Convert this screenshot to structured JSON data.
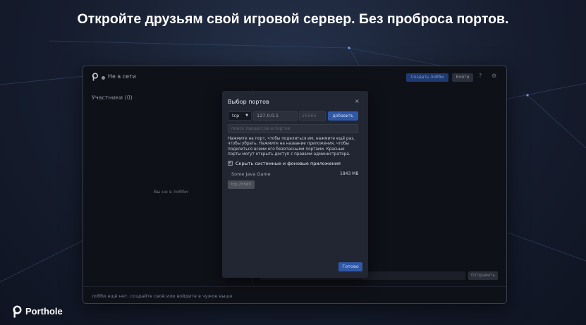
{
  "headline": "Откройте друзьям свой игровой сервер. Без проброса портов.",
  "app": {
    "status": "Не в сети",
    "create_lobby_label": "Создать лобби",
    "login_label": "Войти",
    "help_icon": "question-icon",
    "settings_icon": "gear-icon",
    "participants_label": "Участники (0)",
    "empty_lobby_text": "Вы не в лобби",
    "chat_send_label": "Отправить",
    "footer_text": "лобби ещё нет, создайте своё или войдите в чужое выше"
  },
  "modal": {
    "title": "Выбор портов",
    "close_glyph": "×",
    "protocol": "tcp",
    "ip_value": "127.0.0.1",
    "port_placeholder": "25565",
    "add_label": "добавить",
    "search_placeholder": "поиск процессов и портов",
    "hint": "Нажмите на порт, чтобы поделиться им; нажмите ещё раз, чтобы убрать. Нажмите на название приложения, чтобы поделиться всеми его безопасными портами. Красные порты могут открыть доступ с правами администратора.",
    "hide_system_checked": true,
    "hide_system_label": "Скрыть системные и фоновые приложения",
    "apps": [
      {
        "name": "Some Java Game",
        "memory": "1843 MB",
        "ports": [
          "tcp 25565"
        ]
      }
    ],
    "done_label": "Готово"
  },
  "brand": {
    "name": "Porthole"
  },
  "colors": {
    "accent": "#3058a8",
    "background": "#161d2e",
    "modal": "#222633"
  }
}
